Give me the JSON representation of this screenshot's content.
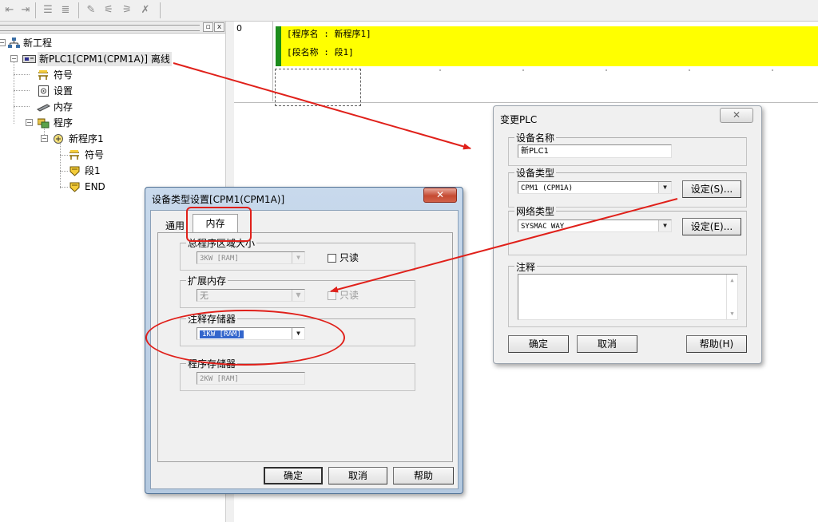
{
  "toolbar": {
    "icons": [
      "indent-left-icon",
      "indent-right-icon",
      "list-icon",
      "list-detail-icon",
      "pen-icon",
      "wand-icon",
      "wand-pen-icon",
      "wand-x-icon"
    ]
  },
  "tree": {
    "root": "新工程",
    "plc": "新PLC1[CPM1(CPM1A)] 离线",
    "symbols": "符号",
    "settings": "设置",
    "memory": "内存",
    "programs": "程序",
    "program1": "新程序1",
    "program1_symbols": "符号",
    "section1": "段1",
    "end": "END",
    "expand_minus": "−"
  },
  "ladder": {
    "rung_number": "0",
    "program_name_line": "[程序名 : 新程序1]",
    "section_name_line": "[段名称 : 段1]",
    "comment_color": "#ffff00",
    "marker_color": "#1c8c1c"
  },
  "change_plc_dialog": {
    "title": "变更PLC",
    "close_label": "✕",
    "device_name_group": "设备名称",
    "device_name_value": "新PLC1",
    "device_type_group": "设备类型",
    "device_type_value": "CPM1 (CPM1A)",
    "device_type_settings": "设定(S)...",
    "network_type_group": "网络类型",
    "network_type_value": "SYSMAC WAY",
    "network_type_settings": "设定(E)...",
    "comment_group": "注释",
    "ok_button": "确定",
    "cancel_button": "取消",
    "help_button": "帮助(H)"
  },
  "device_settings_dialog": {
    "title": "设备类型设置[CPM1(CPM1A)]",
    "close_label": "✕",
    "tabs": [
      "通用",
      "内存"
    ],
    "active_tab": "内存",
    "total_program_area_group": "总程序区域大小",
    "total_program_area_value": "3KW [RAM]",
    "total_program_readonly": "只读",
    "expansion_memory_group": "扩展内存",
    "expansion_memory_value": "无",
    "expansion_readonly": "只读",
    "comment_memory_group": "注释存储器",
    "comment_memory_value": "1KW [RAM]",
    "program_memory_group": "程序存储器",
    "program_memory_value": "2KW [RAM]",
    "ok_button": "确定",
    "cancel_button": "取消",
    "help_button": "帮助"
  },
  "annotations": {
    "color": "#e0201a"
  }
}
